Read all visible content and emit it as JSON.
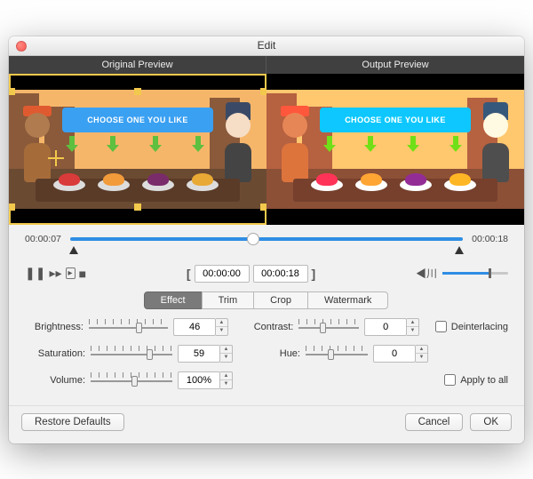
{
  "window": {
    "title": "Edit"
  },
  "preview": {
    "original_label": "Original Preview",
    "output_label": "Output Preview",
    "banner_text": "CHOOSE ONE YOU LIKE"
  },
  "timeline": {
    "current": "00:00:07",
    "total": "00:00:18",
    "playhead_pct": 45,
    "range_start": "00:00:00",
    "range_end": "00:00:18"
  },
  "volume": {
    "level_pct": 70
  },
  "tabs": {
    "items": [
      "Effect",
      "Trim",
      "Crop",
      "Watermark"
    ],
    "active": 0
  },
  "effect": {
    "brightness": {
      "label": "Brightness:",
      "value": "46",
      "pct": 60
    },
    "contrast": {
      "label": "Contrast:",
      "value": "0",
      "pct": 35
    },
    "saturation": {
      "label": "Saturation:",
      "value": "59",
      "pct": 68
    },
    "hue": {
      "label": "Hue:",
      "value": "0",
      "pct": 35
    },
    "volumep": {
      "label": "Volume:",
      "value": "100%",
      "pct": 50
    },
    "deinterlacing": {
      "label": "Deinterlacing",
      "checked": false
    },
    "apply_all": {
      "label": "Apply to all",
      "checked": false
    }
  },
  "buttons": {
    "restore": "Restore Defaults",
    "cancel": "Cancel",
    "ok": "OK"
  }
}
